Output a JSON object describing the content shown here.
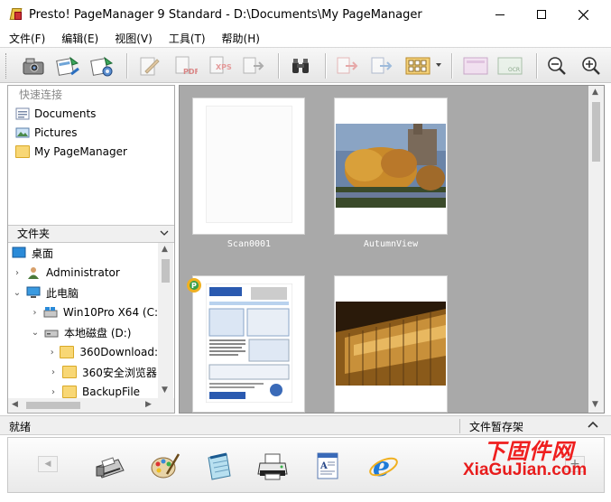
{
  "window": {
    "title": "Presto! PageManager 9 Standard - D:\\Documents\\My PageManager"
  },
  "menu": [
    "文件(F)",
    "编辑(E)",
    "视图(V)",
    "工具(T)",
    "帮助(H)"
  ],
  "toolbar": {
    "icons": [
      "scan-icon",
      "acquire-icon",
      "settings-acquire-icon",
      "edit-icon",
      "save-pdf-icon",
      "save-xps-icon",
      "convert-icon",
      "find-icon",
      "send-icon",
      "send-to-icon",
      "thumbnail-view-icon",
      "view-page-icon",
      "ocr-icon",
      "zoom-out-icon",
      "zoom-in-icon"
    ]
  },
  "quick_links": {
    "header": "快速连接",
    "items": [
      {
        "label": "Documents",
        "icon": "documents-icon"
      },
      {
        "label": "Pictures",
        "icon": "pictures-icon"
      },
      {
        "label": "My PageManager",
        "icon": "folder-icon"
      }
    ]
  },
  "folders": {
    "header": "文件夹",
    "tree": [
      {
        "label": "桌面",
        "icon": "desktop-icon",
        "arrow": "",
        "indent": 0
      },
      {
        "label": "Administrator",
        "icon": "user-icon",
        "arrow": ">",
        "indent": 0
      },
      {
        "label": "此电脑",
        "icon": "computer-icon",
        "arrow": "v",
        "indent": 0
      },
      {
        "label": "Win10Pro X64 (C:",
        "icon": "drive-c-icon",
        "arrow": ">",
        "indent": 1
      },
      {
        "label": "本地磁盘 (D:)",
        "icon": "drive-d-icon",
        "arrow": "v",
        "indent": 1
      },
      {
        "label": "360Download:",
        "icon": "folder-icon",
        "arrow": ">",
        "indent": 2
      },
      {
        "label": "360安全浏览器",
        "icon": "folder-icon",
        "arrow": ">",
        "indent": 2
      },
      {
        "label": "BackupFile",
        "icon": "folder-icon",
        "arrow": ">",
        "indent": 2
      }
    ]
  },
  "thumbnails": [
    {
      "label": "Scan0001",
      "kind": "blank"
    },
    {
      "label": "AutumnView",
      "kind": "photo-autumn"
    },
    {
      "label": "",
      "kind": "brochure"
    },
    {
      "label": "",
      "kind": "photo-building"
    }
  ],
  "status": {
    "left": "就绪",
    "right": "文件暂存架"
  },
  "appbar": {
    "icons": [
      "fax-icon",
      "paint-icon",
      "notepad-icon",
      "printer-icon",
      "document-icon",
      "internet-explorer-icon"
    ]
  },
  "watermark": {
    "cn": "下固件网",
    "url": "XiaGuJian.com"
  },
  "colors": {
    "pane_gray": "#a9a9a9",
    "watermark_red": "#e81c1c"
  }
}
